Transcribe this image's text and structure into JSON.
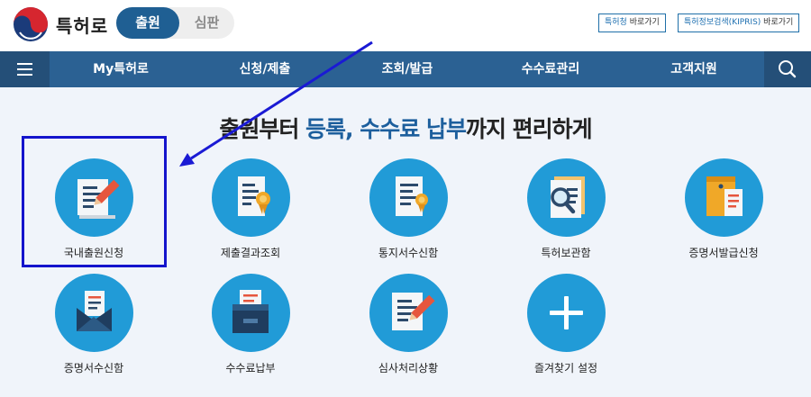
{
  "header": {
    "logo_text": "특허로",
    "segment_active": "출원",
    "segment_inactive": "심판",
    "link_kipo": {
      "accent": "특허청",
      "suffix": " 바로가기"
    },
    "link_kipris": {
      "accent": "특허정보검색(KIPRIS)",
      "suffix": " 바로가기"
    }
  },
  "nav": {
    "items": [
      "My특허로",
      "신청/제출",
      "조회/발급",
      "수수료관리",
      "고객지원"
    ]
  },
  "headline": {
    "part1": "출원부터 ",
    "part2": "등록, 수수료 납부",
    "part3": "까지 편리하게"
  },
  "services": [
    {
      "label": "국내출원신청",
      "icon": "pen-document-icon"
    },
    {
      "label": "제출결과조회",
      "icon": "certificate-document-icon"
    },
    {
      "label": "통지서수신함",
      "icon": "notice-document-icon"
    },
    {
      "label": "특허보관함",
      "icon": "magnifier-document-icon"
    },
    {
      "label": "증명서발급신청",
      "icon": "envelope-document-icon"
    },
    {
      "label": "증명서수신함",
      "icon": "open-envelope-icon"
    },
    {
      "label": "수수료납부",
      "icon": "fee-box-icon"
    },
    {
      "label": "심사처리상황",
      "icon": "pen-document-icon"
    },
    {
      "label": "즐겨찾기 설정",
      "icon": "plus-icon"
    }
  ],
  "colors": {
    "nav_bar": "#2b6193",
    "segment_active": "#1f5f93",
    "icon_circle": "#219bd7",
    "headline_accent": "#1d5f9d",
    "selection_box": "#1414cc"
  }
}
